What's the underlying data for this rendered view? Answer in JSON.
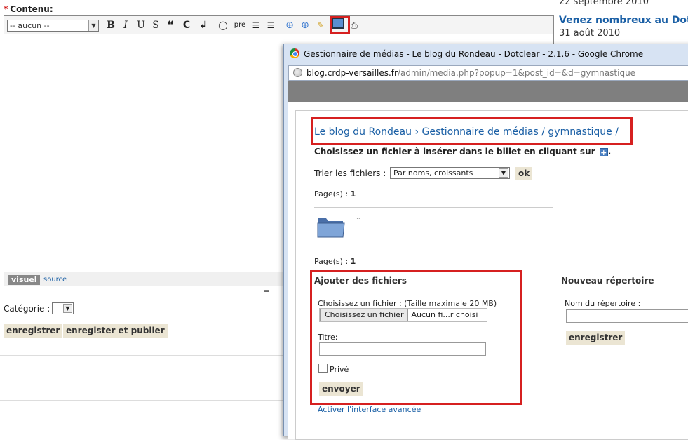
{
  "editor": {
    "required_mark": "*",
    "label": "Contenu:",
    "format_select": "-- aucun --",
    "toolbar": {
      "bold": "B",
      "italic": "I",
      "underline": "U",
      "strike": "S",
      "quote": "“",
      "code": "C",
      "br": "↲",
      "acronym": "💬",
      "pre": "pre",
      "ul": "☰",
      "ol": "☰"
    },
    "tab_visuel": "visuel",
    "tab_source": "source",
    "grip": "═",
    "category_label": "Catégorie :",
    "save_label": "enregistrer",
    "save_publish_label": "enregister et publier"
  },
  "sidebar": {
    "date1": "22 septembre 2010",
    "link": "Venez nombreux au Dotc",
    "date2": "31 août 2010"
  },
  "popup": {
    "title": "Gestionnaire de médias - Le blog du Rondeau - Dotclear - 2.1.6 - Google Chrome",
    "url_domain": "blog.crdp-versailles.fr",
    "url_path": "/admin/media.php?popup=1&post_id=&d=gymnastique",
    "breadcrumb": {
      "blog": "Le blog du Rondeau",
      "sep": "›",
      "media": "Gestionnaire de médias",
      "slash": "/",
      "folder": "gymnastique",
      "tail": "/"
    },
    "instruction": "Choisissez un fichier à insérer dans le billet en cliquant sur",
    "instruction_end": ".",
    "sort_label": "Trier les fichiers :",
    "sort_value": "Par noms, croissants",
    "ok_label": "ok",
    "pages_label": "Page(s) :",
    "pages_value": "1",
    "folder_dots": "..",
    "upload": {
      "heading": "Ajouter des fichiers",
      "file_label": "Choisissez un fichier : (Taille maximale 20 MB)",
      "file_button": "Choisissez un fichier",
      "file_status": "Aucun fi...r choisi",
      "title_label": "Titre:",
      "private_label": "Privé",
      "send_label": "envoyer",
      "advanced_link": "Activer l'interface avancée"
    },
    "newdir": {
      "heading": "Nouveau répertoire",
      "name_label": "Nom du répertoire :",
      "save_label": "enregistrer"
    }
  },
  "colors": {
    "accent_link": "#1a5fa5",
    "highlight_red": "#d62020",
    "button_beige": "#ebe5d3"
  }
}
